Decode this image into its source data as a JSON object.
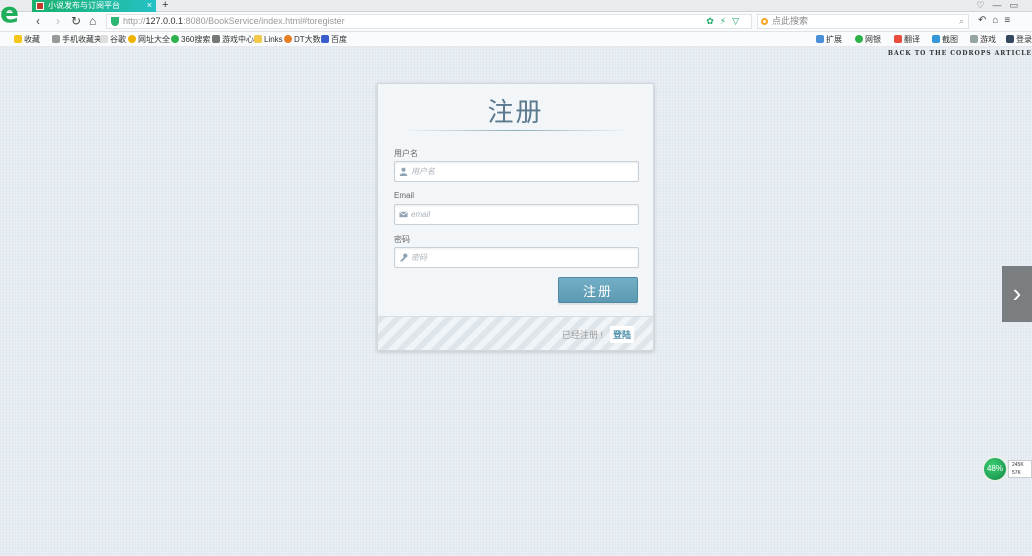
{
  "browser": {
    "tab_title": "小说发布与订阅平台",
    "tab_close": "×",
    "new_tab": "+",
    "url_prefix": "http://",
    "url_host": "127.0.0.1",
    "url_rest": ":8080/BookService/index.html#toregister",
    "search_placeholder": "点此搜索",
    "bookmarks": [
      "收藏",
      "手机收藏夹",
      "谷歌",
      "网址大全",
      "360搜索",
      "游戏中心",
      "Links",
      "DT大数",
      "百度"
    ],
    "right_bookmarks": [
      "扩展",
      "网银",
      "翻译",
      "截图",
      "游戏",
      "登录"
    ]
  },
  "page": {
    "back_link": "BACK TO THE CODROPS ARTICLE"
  },
  "form": {
    "title": "注册",
    "username_label": "用户名",
    "username_placeholder": "用户名",
    "email_label": "Email",
    "email_placeholder": "email",
    "password_label": "密码",
    "password_placeholder": "密码",
    "submit_label": "注册",
    "already_registered": "已经注册 !",
    "login_link": "登陆"
  },
  "widget": {
    "percent": "48%",
    "up": "245K",
    "down": "57K"
  },
  "colors": {
    "accent": "#5d9ab3",
    "title": "#5b7a8d",
    "browser_green": "#1fae5a"
  }
}
